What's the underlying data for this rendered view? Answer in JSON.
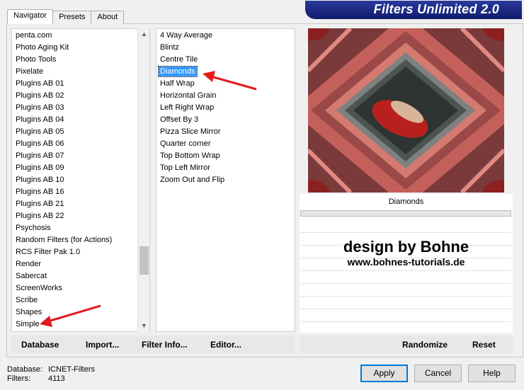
{
  "banner_title": "Filters Unlimited 2.0",
  "tabs": [
    "Navigator",
    "Presets",
    "About"
  ],
  "categories": [
    "penta.com",
    "Photo Aging Kit",
    "Photo Tools",
    "Pixelate",
    "Plugins AB 01",
    "Plugins AB 02",
    "Plugins AB 03",
    "Plugins AB 04",
    "Plugins AB 05",
    "Plugins AB 06",
    "Plugins AB 07",
    "Plugins AB 09",
    "Plugins AB 10",
    "Plugins AB 16",
    "Plugins AB 21",
    "Plugins AB 22",
    "Psychosis",
    "Random Filters (for Actions)",
    "RCS Filter Pak 1.0",
    "Render",
    "Sabercat",
    "ScreenWorks",
    "Scribe",
    "Shapes",
    "Simple"
  ],
  "filters": [
    "4 Way Average",
    "Blintz",
    "Centre Tile",
    "Diamonds",
    "Half Wrap",
    "Horizontal Grain",
    "Left Right Wrap",
    "Offset By 3",
    "Pizza Slice Mirror",
    "Quarter corner",
    "Top Bottom Wrap",
    "Top Left Mirror",
    "Zoom Out and Flip"
  ],
  "selected_filter": "Diamonds",
  "preview_filter_name": "Diamonds",
  "watermark": {
    "line1": "design by Bohne",
    "line2": "www.bohnes-tutorials.de"
  },
  "left_buttons": {
    "database": "Database",
    "import": "Import...",
    "filter_info": "Filter Info...",
    "editor": "Editor..."
  },
  "right_buttons": {
    "randomize": "Randomize",
    "reset": "Reset"
  },
  "status": {
    "database_label": "Database:",
    "database_value": "ICNET-Filters",
    "filters_label": "Filters:",
    "filters_value": "4113"
  },
  "dialog_buttons": {
    "apply": "Apply",
    "cancel": "Cancel",
    "help": "Help"
  },
  "colors": {
    "banner": "#1b2a85",
    "selection": "#3399ff",
    "arrow": "#e31b1b"
  }
}
